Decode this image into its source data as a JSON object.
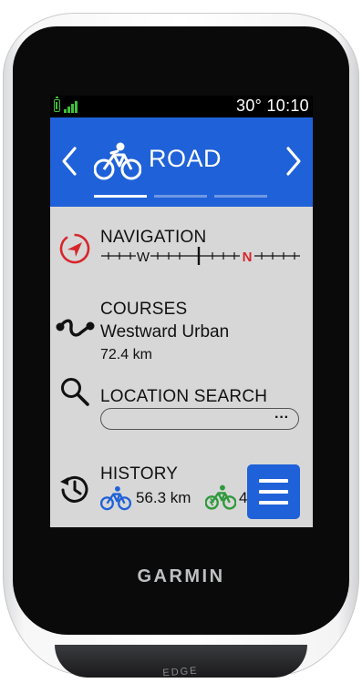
{
  "device": {
    "brand": "GARMIN",
    "bottom_lettering": "EDGE"
  },
  "status_bar": {
    "battery_icon": "battery-icon",
    "signal_icon": "signal-icon",
    "temperature": "30°",
    "time": "10:10",
    "text": "30°  10:10",
    "accent_color": "#3fbf3a"
  },
  "header": {
    "profile_name": "ROAD",
    "profile_icon": "road-bike-icon",
    "prev_icon": "chevron-left-icon",
    "next_icon": "chevron-right-icon",
    "background_color": "#1f61d8",
    "pages": [
      {
        "active": true
      },
      {
        "active": false
      },
      {
        "active": false
      }
    ]
  },
  "menu": {
    "navigation": {
      "label": "NAVIGATION",
      "icon": "compass-icon",
      "compass_letters": [
        "W",
        "N"
      ]
    },
    "courses": {
      "label": "COURSES",
      "icon": "course-path-icon",
      "course_name": "Westward Urban",
      "distance": "72.4 km"
    },
    "location_search": {
      "label": "LOCATION SEARCH",
      "icon": "search-icon",
      "more_label": "···"
    },
    "history": {
      "label": "HISTORY",
      "icon": "history-icon",
      "road_distance": "56.3 km",
      "road_icon": "road-bike-icon",
      "ebike_value": "4",
      "ebike_icon": "e-bike-icon"
    }
  },
  "menu_button": {
    "icon": "hamburger-menu-icon",
    "color": "#1f61d8"
  }
}
